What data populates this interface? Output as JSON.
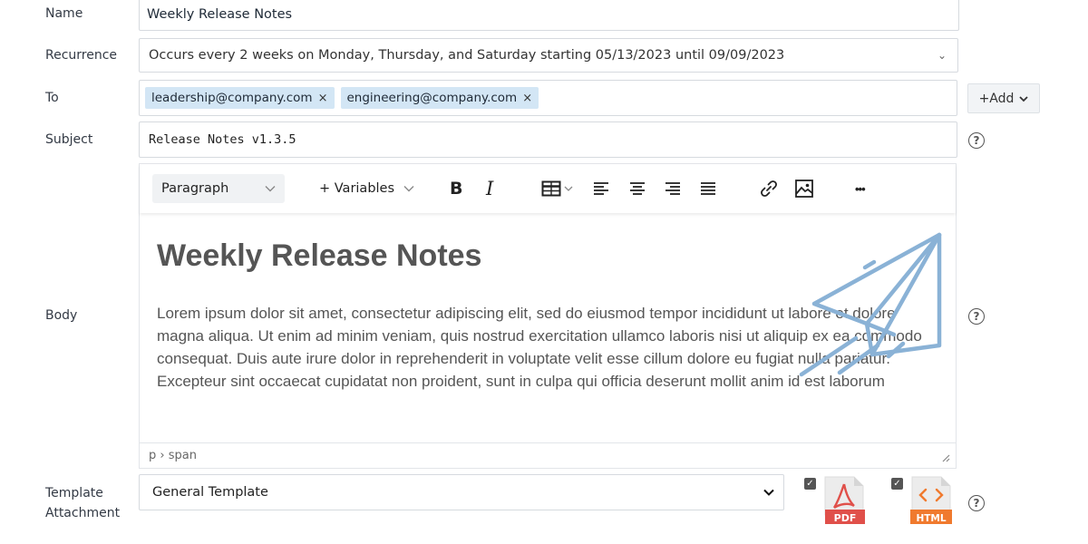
{
  "form": {
    "name_label": "Name",
    "name_value": "Weekly Release Notes",
    "recurrence_label": "Recurrence",
    "recurrence_value": "Occurs every 2 weeks on Monday, Thursday, and Saturday starting 05/13/2023 until 09/09/2023",
    "to_label": "To",
    "recipients": [
      {
        "email": "leadership@company.com",
        "remove": "×"
      },
      {
        "email": "engineering@company.com",
        "remove": "×"
      }
    ],
    "add_label": "+Add",
    "subject_label": "Subject",
    "subject_value": "Release Notes v1.3.5",
    "body_label": "Body",
    "template_label_line1": "Template",
    "template_label_line2": "Attachment",
    "template_value": "General Template",
    "help_glyph": "?"
  },
  "editor": {
    "block_format": "Paragraph",
    "variables_label": "+ Variables",
    "bold_label": "B",
    "italic_label": "I",
    "more_label": "•••",
    "heading": "Weekly Release Notes",
    "paragraph": "Lorem ipsum dolor sit amet, consectetur adipiscing elit, sed do eiusmod tempor incididunt ut labore et dolore magna aliqua. Ut enim ad minim veniam, quis nostrud exercitation ullamco laboris nisi ut aliquip ex ea commodo consequat. Duis aute irure dolor in reprehenderit in voluptate velit esse cillum dolore eu fugiat nulla pariatur. Excepteur sint occaecat cupidatat non proident, sunt in culpa qui officia deserunt mollit anim id est laborum",
    "status_path": "p › span"
  },
  "attachments": [
    {
      "type": "PDF",
      "checked": true,
      "color": "#e0504a"
    },
    {
      "type": "HTML",
      "checked": true,
      "color": "#f07a2e"
    }
  ],
  "colors": {
    "chip_bg": "#d3e6f5",
    "plane_icon": "#8ab2d6"
  },
  "icons": [
    "chevron-down-icon",
    "close-icon",
    "help-icon",
    "bold-icon",
    "italic-icon",
    "table-icon",
    "align-left-icon",
    "align-center-icon",
    "align-right-icon",
    "align-justify-icon",
    "link-icon",
    "image-icon",
    "more-icon",
    "paper-plane-icon",
    "pdf-file-icon",
    "html-file-icon",
    "resize-handle-icon",
    "checkbox-icon"
  ]
}
